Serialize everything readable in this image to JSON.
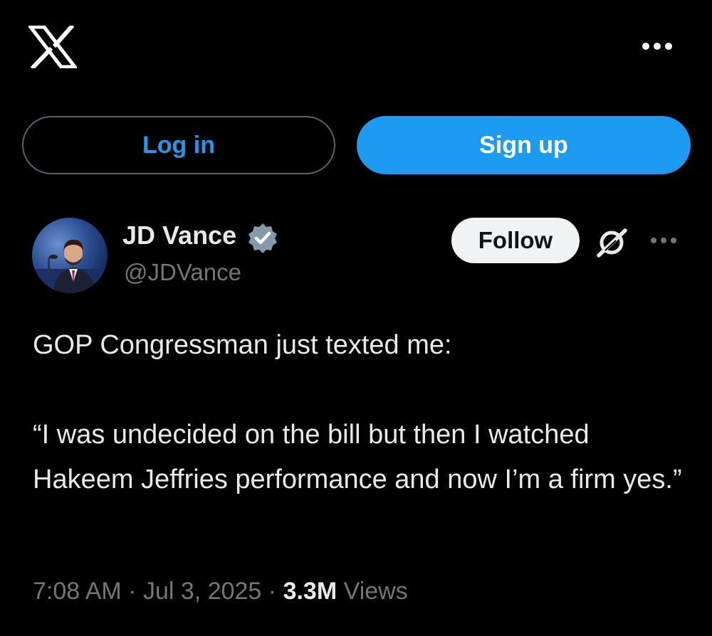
{
  "header": {
    "logo_icon": "x-logo-icon",
    "more_icon": "more-horizontal-icon"
  },
  "auth": {
    "login_label": "Log in",
    "signup_label": "Sign up"
  },
  "tweet": {
    "author": {
      "name": "JD Vance",
      "handle": "@JDVance",
      "verified_icon": "verified-badge-icon"
    },
    "follow_label": "Follow",
    "grok_icon": "grok-icon",
    "more_icon": "more-horizontal-icon",
    "text": {
      "line1": "GOP Congressman just texted me:",
      "quote": "“I was undecided on the bill but then I watched Hakeem Jeffries performance and now I’m a firm yes.”"
    },
    "meta": {
      "time": "7:08 AM",
      "separator": "·",
      "date": "Jul 3, 2025",
      "views_count": "3.3M",
      "views_label": "Views"
    }
  },
  "colors": {
    "background": "#000000",
    "accent": "#1d9bf0",
    "text_primary": "#e7e9ea",
    "text_secondary": "#71767b",
    "follow_bg": "#eff3f4"
  }
}
